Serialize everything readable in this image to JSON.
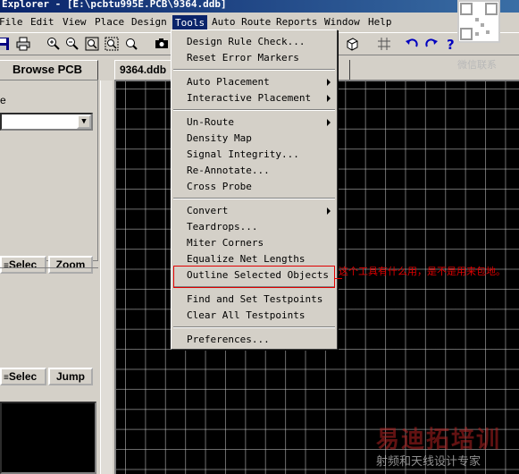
{
  "window": {
    "title": "Explorer - [E:\\pcbtu995E.PCB\\9364.ddb]"
  },
  "menubar": {
    "items": [
      "File",
      "Edit",
      "View",
      "Place",
      "Design",
      "Tools",
      "Auto Route",
      "Reports",
      "Window",
      "Help"
    ],
    "active": "Tools"
  },
  "toolbar": {
    "icons": [
      "save-icon",
      "print-icon",
      "zoom-in-icon",
      "zoom-out-icon",
      "zoom-fit-icon",
      "zoom-area-icon",
      "camera-icon",
      "3d-icon",
      "grid-icon",
      "undo-icon",
      "redo-icon",
      "help-icon"
    ]
  },
  "left_panel": {
    "tab": "Browse PCB",
    "label": "e",
    "btn_select_1": "Selec",
    "btn_zoom": "Zoom",
    "btn_select_2": "Selec",
    "btn_jump": "Jump"
  },
  "document_tab": "9364.ddb",
  "tools_menu": {
    "groups": [
      [
        {
          "label": "Design Rule Check..."
        },
        {
          "label": "Reset Error Markers"
        }
      ],
      [
        {
          "label": "Auto Placement",
          "submenu": true
        },
        {
          "label": "Interactive Placement",
          "submenu": true
        }
      ],
      [
        {
          "label": "Un-Route",
          "submenu": true
        },
        {
          "label": "Density Map"
        },
        {
          "label": "Signal Integrity..."
        },
        {
          "label": "Re-Annotate..."
        },
        {
          "label": "Cross Probe"
        }
      ],
      [
        {
          "label": "Convert",
          "submenu": true
        },
        {
          "label": "Teardrops..."
        },
        {
          "label": "Miter Corners"
        },
        {
          "label": "Equalize Net Lengths"
        },
        {
          "label": "Outline Selected Objects"
        }
      ],
      [
        {
          "label": "Find and Set Testpoints"
        },
        {
          "label": "Clear All Testpoints"
        }
      ],
      [
        {
          "label": "Preferences..."
        }
      ]
    ]
  },
  "annotation": {
    "text": "这个工具有什么用，是不是用来包地。",
    "color": "#e00000"
  },
  "watermark": {
    "qr_label": "微信联系",
    "main": "易迪拓培训",
    "sub": "射频和天线设计专家"
  },
  "colors": {
    "menu_highlight": "#0a246a",
    "chrome": "#d4d0c8",
    "canvas": "#000000"
  }
}
